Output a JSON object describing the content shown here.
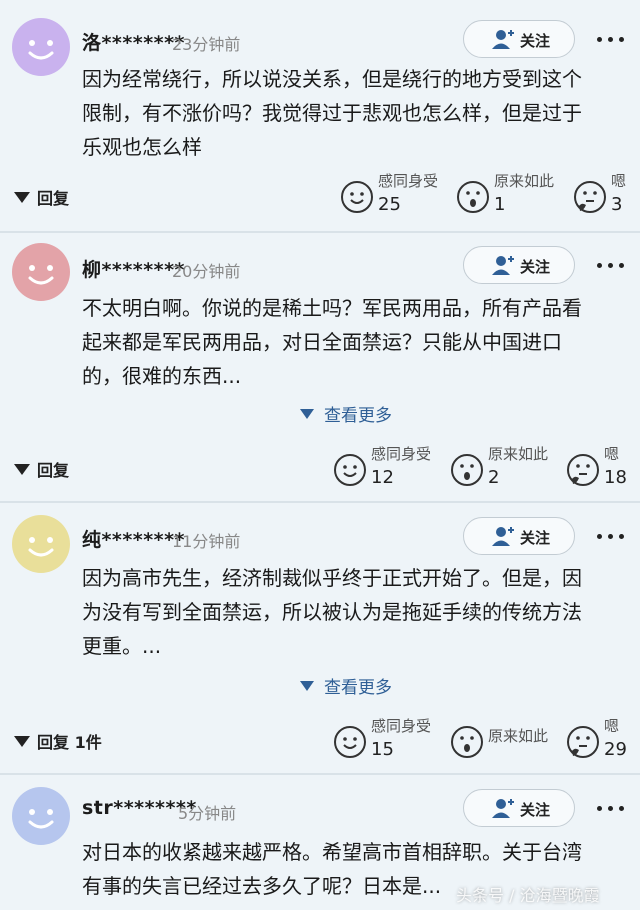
{
  "ui": {
    "follow_label": "关注",
    "expand_label": "查看更多"
  },
  "comments": [
    {
      "avatar_color": "#c9b2ee",
      "name": "洛********",
      "time": "23分钟前",
      "lines": [
        "因为经常绕行，所以说没关系，但是绕行的地方受到这个",
        "限制，有不涨价吗？我觉得过于悲观也怎么样，但是过于",
        "乐观也怎么样"
      ],
      "reply": "回复",
      "reactions": [
        {
          "label": "感同身受",
          "count": "25"
        },
        {
          "label": "原来如此",
          "count": "1"
        },
        {
          "label": "嗯",
          "count": "3"
        }
      ]
    },
    {
      "avatar_color": "#e3a3a8",
      "name": "柳********",
      "time": "20分钟前",
      "lines": [
        "不太明白啊。你说的是稀土吗？军民两用品，所有产品看",
        "起来都是军民两用品，对日全面禁运？只能从中国进口",
        "的，很难的东西..."
      ],
      "reply": "回复",
      "reactions": [
        {
          "label": "感同身受",
          "count": "12"
        },
        {
          "label": "原来如此",
          "count": "2"
        },
        {
          "label": "嗯",
          "count": "18"
        }
      ]
    },
    {
      "avatar_color": "#e9df9a",
      "name": "纯********",
      "time": "11分钟前",
      "lines": [
        "因为高市先生，经济制裁似乎终于正式开始了。但是，因",
        "为没有写到全面禁运，所以被认为是拖延手续的传统方法",
        "更重。..."
      ],
      "reply": "回复 1件",
      "reactions": [
        {
          "label": "感同身受",
          "count": "15"
        },
        {
          "label": "原来如此",
          "count": ""
        },
        {
          "label": "嗯",
          "count": "29"
        }
      ]
    },
    {
      "avatar_color": "#b6c6ee",
      "name": "str********",
      "time": "5分钟前",
      "lines": [
        "对日本的收紧越来越严格。希望高市首相辞职。关于台湾",
        "有事的失言已经过去多久了呢？日本是..."
      ]
    }
  ],
  "watermark": "头条号 / 沧海暨晚霞"
}
